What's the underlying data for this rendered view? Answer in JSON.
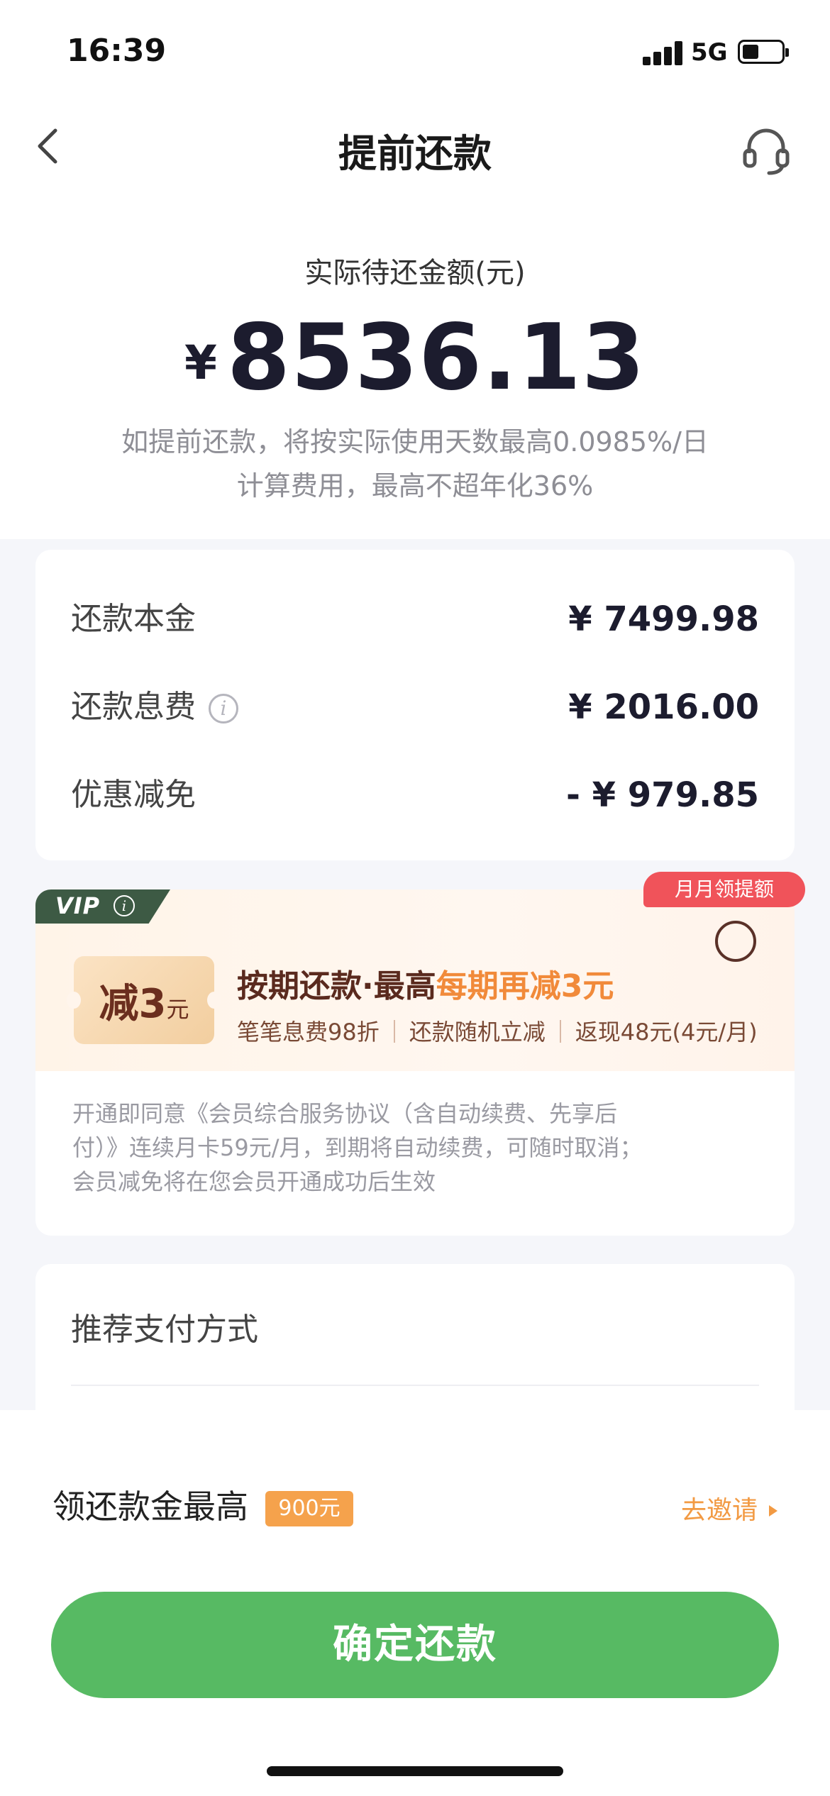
{
  "status_bar": {
    "time": "16:39",
    "network": "5G"
  },
  "nav": {
    "title": "提前还款"
  },
  "amount": {
    "label": "实际待还金额(元)",
    "currency": "¥",
    "value": "8536.13",
    "notice_line1": "如提前还款，将按实际使用天数最高0.0985%/日",
    "notice_line2": "计算费用，最高不超年化36%"
  },
  "details": {
    "principal_label": "还款本金",
    "principal_value": "¥ 7499.98",
    "fee_label": "还款息费",
    "fee_value": "¥ 2016.00",
    "discount_label": "优惠减免",
    "discount_value": "- ¥ 979.85"
  },
  "vip": {
    "tag": "VIP",
    "badge": "月月领提额",
    "coupon_main": "减3",
    "coupon_unit": "元",
    "title_prefix": "按期还款·最高",
    "title_highlight": "每期再减3元",
    "perk_1": "笔笔息费98折",
    "perk_2": "还款随机立减",
    "perk_3": "返现48元(4元/月)",
    "agree_1": "开通即同意《会员综合服务协议（含自动续费、先享后",
    "agree_2": "付）》连续月卡59元/月，到期将自动续费，可随时取消；",
    "agree_3": "会员减免将在您会员开通成功后生效"
  },
  "payment": {
    "title": "推荐支付方式"
  },
  "reward": {
    "label": "领还款金最高",
    "badge": "900元",
    "invite": "去邀请"
  },
  "confirm": {
    "label": "确定还款"
  },
  "colors": {
    "primary_green": "#57BA63",
    "accent_orange": "#F29A43",
    "badge_red": "#F0535A",
    "vip_green": "#3D5A44"
  }
}
